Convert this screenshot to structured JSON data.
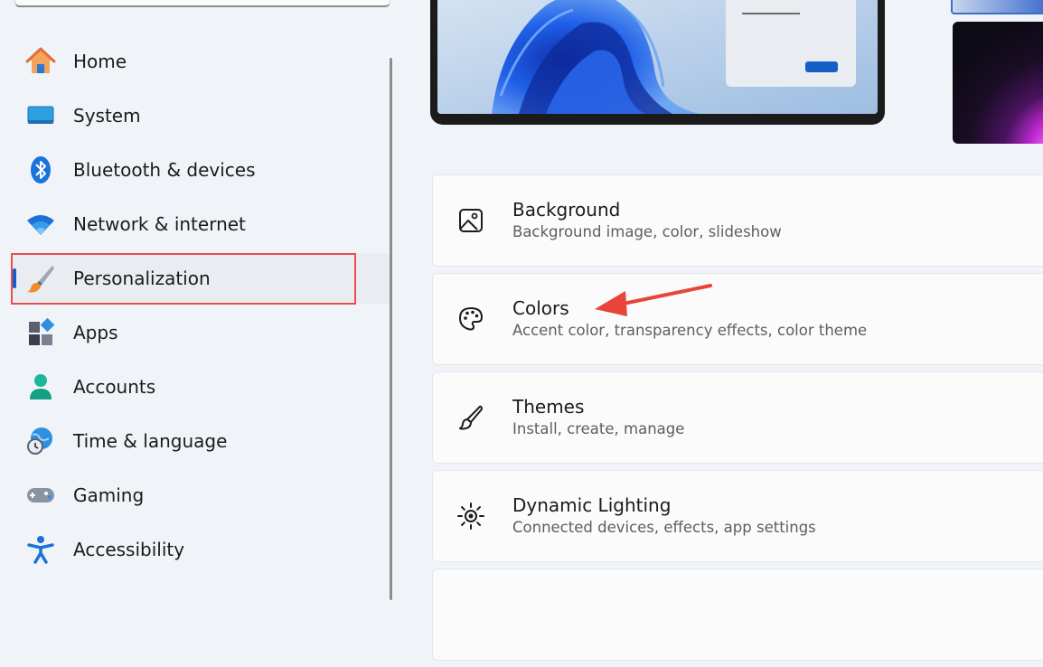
{
  "sidebar": {
    "items": [
      {
        "label": "Home",
        "icon": "home-icon",
        "active": false
      },
      {
        "label": "System",
        "icon": "system-icon",
        "active": false
      },
      {
        "label": "Bluetooth & devices",
        "icon": "bluetooth-icon",
        "active": false
      },
      {
        "label": "Network & internet",
        "icon": "wifi-icon",
        "active": false
      },
      {
        "label": "Personalization",
        "icon": "paintbrush-icon",
        "active": true
      },
      {
        "label": "Apps",
        "icon": "apps-icon",
        "active": false
      },
      {
        "label": "Accounts",
        "icon": "account-icon",
        "active": false
      },
      {
        "label": "Time & language",
        "icon": "globe-clock-icon",
        "active": false
      },
      {
        "label": "Gaming",
        "icon": "gamepad-icon",
        "active": false
      },
      {
        "label": "Accessibility",
        "icon": "accessibility-icon",
        "active": false
      }
    ]
  },
  "main": {
    "settings": [
      {
        "title": "Background",
        "subtitle": "Background image, color, slideshow",
        "icon": "image-icon"
      },
      {
        "title": "Colors",
        "subtitle": "Accent color, transparency effects, color theme",
        "icon": "palette-icon"
      },
      {
        "title": "Themes",
        "subtitle": "Install, create, manage",
        "icon": "brush-icon"
      },
      {
        "title": "Dynamic Lighting",
        "subtitle": "Connected devices, effects, app settings",
        "icon": "sun-icon"
      }
    ]
  },
  "colors": {
    "accent": "#1560c6",
    "highlight": "#e8504f",
    "arrow": "#e8443a"
  }
}
